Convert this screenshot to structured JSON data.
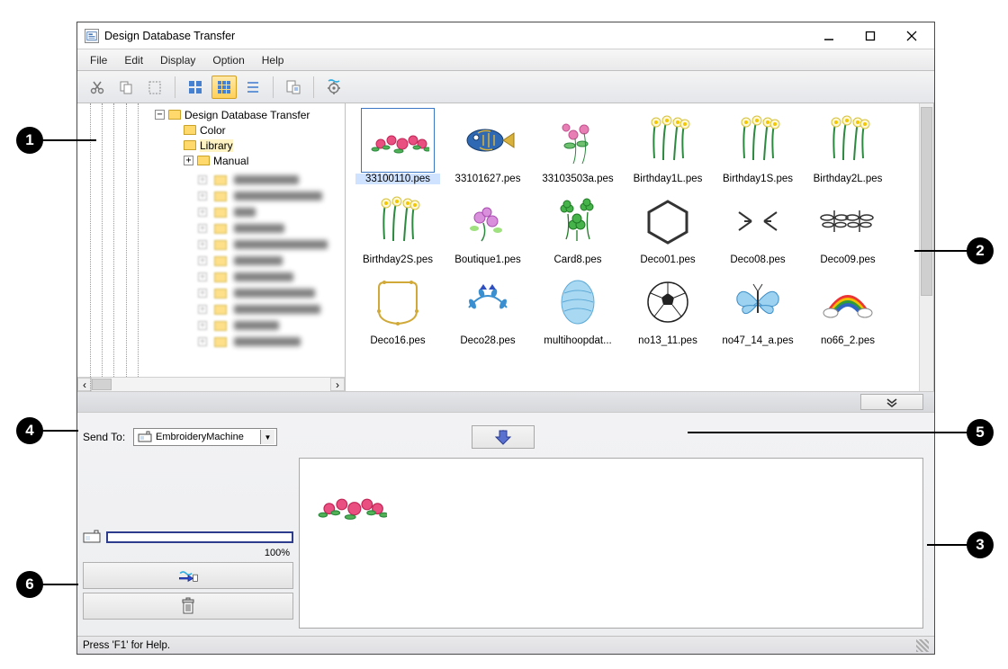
{
  "title": "Design Database Transfer",
  "menu": [
    "File",
    "Edit",
    "Display",
    "Option",
    "Help"
  ],
  "toolbar": {
    "buttons": [
      "cut",
      "copy",
      "paste",
      "view-large",
      "view-small",
      "view-list",
      "print",
      "settings"
    ],
    "active_view": "view-small"
  },
  "tree": {
    "root": "Design Database Transfer",
    "children": [
      "Color",
      "Library",
      "Manual"
    ],
    "selected": "Library",
    "blurred_count": 11
  },
  "thumbnails": [
    {
      "file": "33100110.pes",
      "art": "roses",
      "selected": true
    },
    {
      "file": "33101627.pes",
      "art": "fish"
    },
    {
      "file": "33103503a.pes",
      "art": "bouquet"
    },
    {
      "file": "Birthday1L.pes",
      "art": "narcissus"
    },
    {
      "file": "Birthday1S.pes",
      "art": "narcissus2"
    },
    {
      "file": "Birthday2L.pes",
      "art": "narcissus3"
    },
    {
      "file": "Birthday2S.pes",
      "art": "narcissus4"
    },
    {
      "file": "Boutique1.pes",
      "art": "orchid"
    },
    {
      "file": "Card8.pes",
      "art": "clover"
    },
    {
      "file": "Deco01.pes",
      "art": "hexagon"
    },
    {
      "file": "Deco08.pes",
      "art": "arrows"
    },
    {
      "file": "Deco09.pes",
      "art": "dragonflies"
    },
    {
      "file": "Deco16.pes",
      "art": "frame"
    },
    {
      "file": "Deco28.pes",
      "art": "wreath"
    },
    {
      "file": "multihoopdat...",
      "art": "egg"
    },
    {
      "file": "no13_11.pes",
      "art": "soccer"
    },
    {
      "file": "no47_14_a.pes",
      "art": "butterfly"
    },
    {
      "file": "no66_2.pes",
      "art": "rainbow"
    }
  ],
  "send": {
    "label": "Send To:",
    "selected": "EmbroideryMachine"
  },
  "capacity": {
    "percent_text": "100%"
  },
  "writelist": {
    "items": [
      {
        "art": "roses"
      }
    ]
  },
  "status": "Press 'F1' for Help.",
  "callouts": [
    "1",
    "2",
    "3",
    "4",
    "5",
    "6"
  ]
}
